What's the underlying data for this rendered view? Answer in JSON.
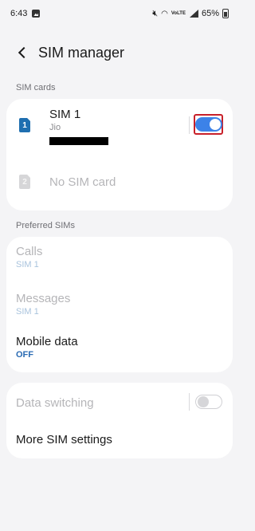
{
  "status_bar": {
    "time": "6:43",
    "battery": "65%",
    "volte": "VoLTE"
  },
  "header": {
    "title": "SIM manager"
  },
  "sim_cards": {
    "section_label": "SIM cards",
    "sim1": {
      "slot": "1",
      "name": "SIM 1",
      "carrier": "Jio",
      "enabled": true
    },
    "sim2": {
      "slot": "2",
      "name": "No SIM card"
    }
  },
  "preferred": {
    "section_label": "Preferred SIMs",
    "calls": {
      "label": "Calls",
      "value": "SIM 1"
    },
    "messages": {
      "label": "Messages",
      "value": "SIM 1"
    },
    "mobile_data": {
      "label": "Mobile data",
      "value": "OFF"
    }
  },
  "more": {
    "data_switching": {
      "label": "Data switching",
      "enabled": false
    },
    "more_settings": {
      "label": "More SIM settings"
    }
  },
  "colors": {
    "accent": "#3c82e8",
    "sim_badge": "#1f6fb0",
    "highlight": "#c8202a"
  }
}
